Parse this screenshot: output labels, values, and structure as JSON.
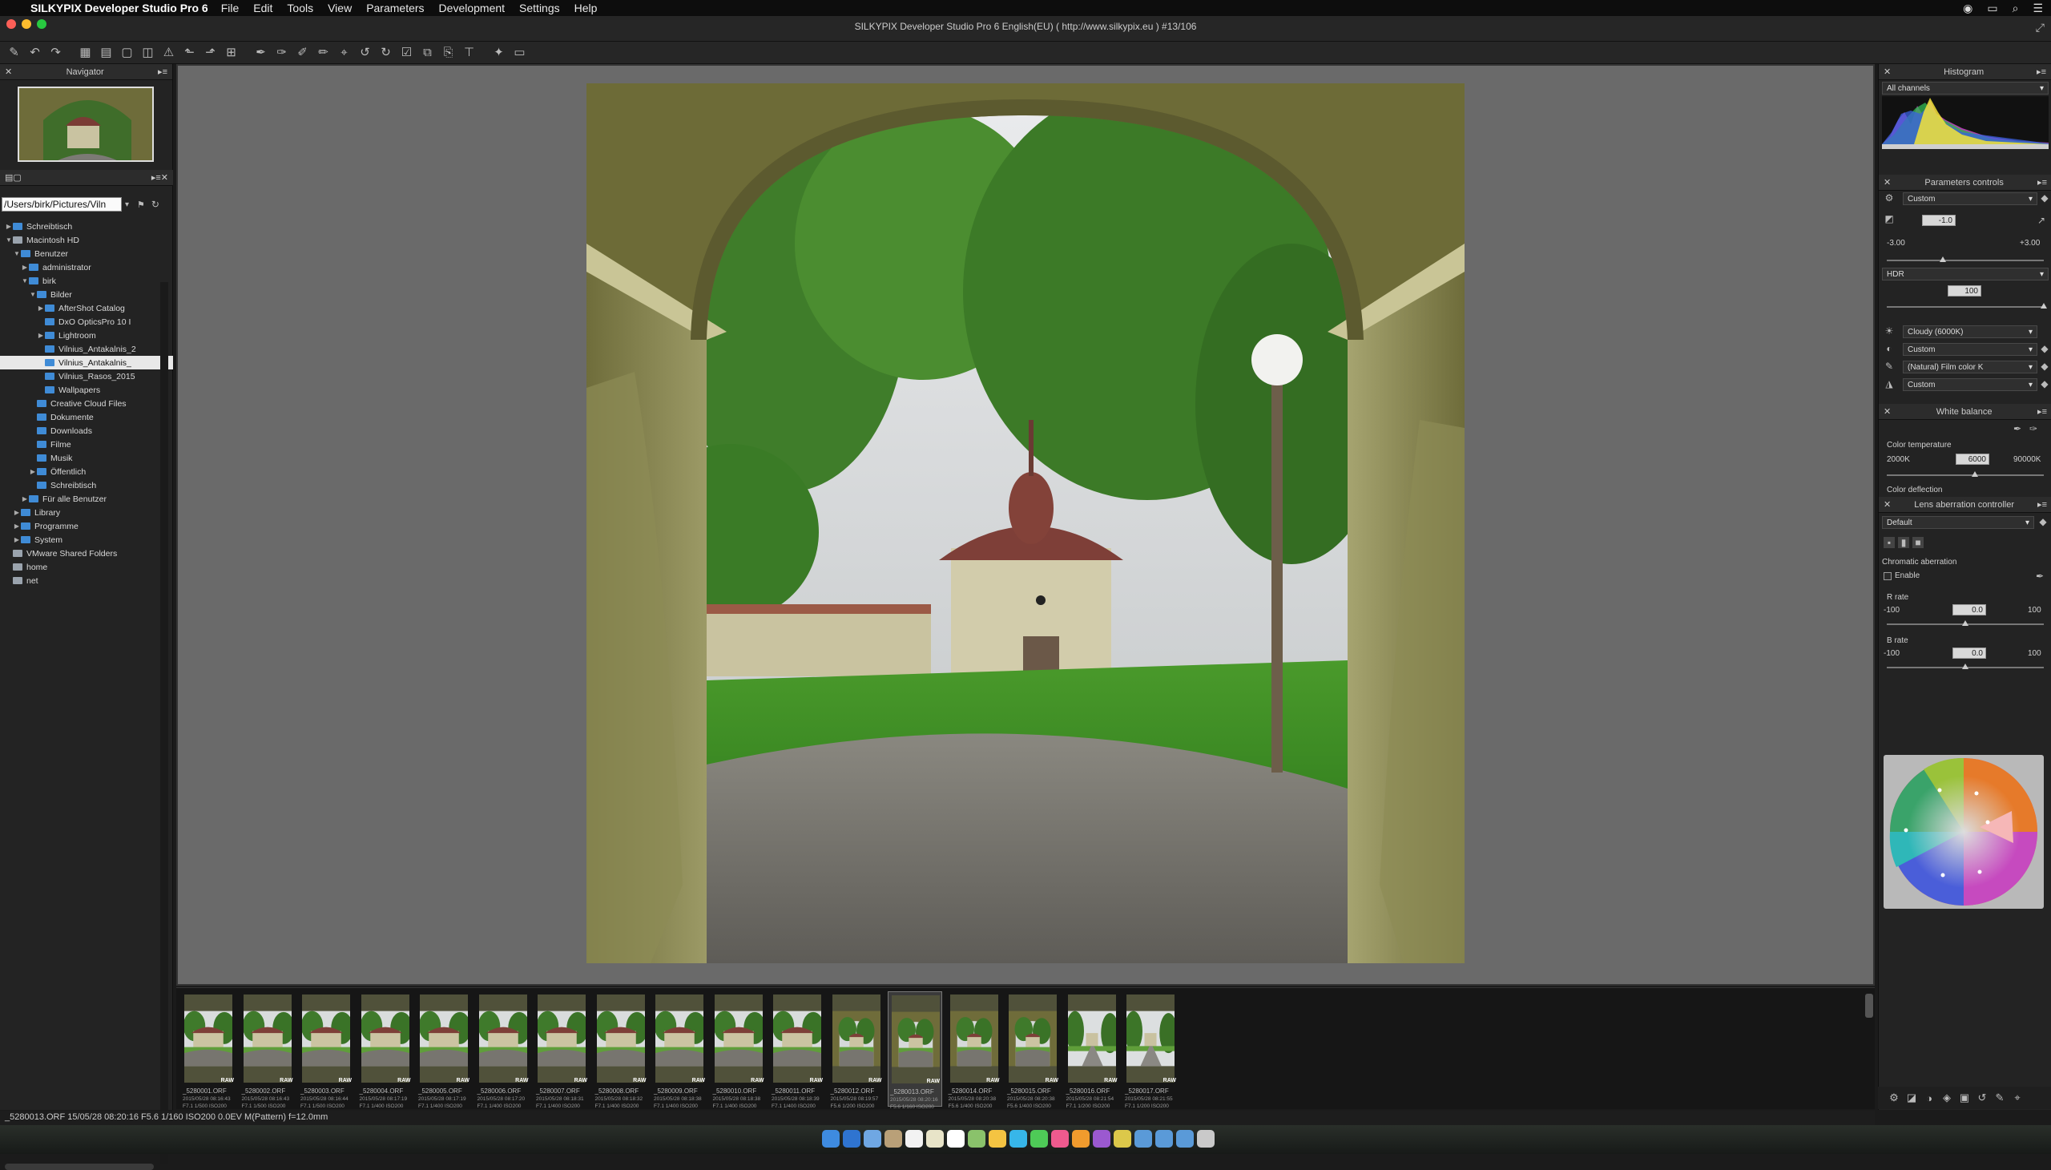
{
  "menubar": {
    "app_name": "SILKYPIX Developer Studio Pro 6",
    "menus": [
      "File",
      "Edit",
      "Tools",
      "View",
      "Parameters",
      "Development",
      "Settings",
      "Help"
    ]
  },
  "window": {
    "title": "SILKYPIX Developer Studio Pro 6 English(EU) ( http://www.silkypix.eu )  #13/106"
  },
  "toolbar": {
    "icons": [
      "pen-develop-icon",
      "undo-icon",
      "redo-icon",
      "grid-view-icon",
      "combined-view-icon",
      "preview-icon",
      "compare-icon",
      "warning-icon",
      "rotate-left-icon",
      "rotate-right-icon",
      "crop-grid-icon",
      "dropper-icon",
      "gray-dropper-icon",
      "brush-icon",
      "pen-icon",
      "spot-icon",
      "rotate-ccw-icon",
      "rotate-cw-icon",
      "check-mark-icon",
      "copy-params-icon",
      "paste-params-icon",
      "straighten-icon",
      "highlight-icon",
      "develop-output-icon"
    ]
  },
  "left_panel": {
    "navigator_title": "Navigator",
    "path_value": "/Users/birk/Pictures/Viln",
    "tree": [
      {
        "label": "Schreibtisch",
        "indent": 0,
        "tw": "▶",
        "drive": false,
        "sel": false
      },
      {
        "label": "Macintosh HD",
        "indent": 0,
        "tw": "▼",
        "drive": true,
        "sel": false
      },
      {
        "label": "Benutzer",
        "indent": 1,
        "tw": "▼",
        "drive": false,
        "sel": false
      },
      {
        "label": "administrator",
        "indent": 2,
        "tw": "▶",
        "drive": false,
        "sel": false
      },
      {
        "label": "birk",
        "indent": 2,
        "tw": "▼",
        "drive": false,
        "sel": false
      },
      {
        "label": "Bilder",
        "indent": 3,
        "tw": "▼",
        "drive": false,
        "sel": false
      },
      {
        "label": "AfterShot Catalog",
        "indent": 4,
        "tw": "▶",
        "drive": false,
        "sel": false
      },
      {
        "label": "DxO OpticsPro 10 I",
        "indent": 4,
        "tw": "",
        "drive": false,
        "sel": false
      },
      {
        "label": "Lightroom",
        "indent": 4,
        "tw": "▶",
        "drive": false,
        "sel": false
      },
      {
        "label": "Vilnius_Antakalnis_2",
        "indent": 4,
        "tw": "",
        "drive": false,
        "sel": false
      },
      {
        "label": "Vilnius_Antakalnis_",
        "indent": 4,
        "tw": "",
        "drive": false,
        "sel": true
      },
      {
        "label": "Vilnius_Rasos_2015",
        "indent": 4,
        "tw": "",
        "drive": false,
        "sel": false
      },
      {
        "label": "Wallpapers",
        "indent": 4,
        "tw": "",
        "drive": false,
        "sel": false
      },
      {
        "label": "Creative Cloud Files",
        "indent": 3,
        "tw": "",
        "drive": false,
        "sel": false
      },
      {
        "label": "Dokumente",
        "indent": 3,
        "tw": "",
        "drive": false,
        "sel": false
      },
      {
        "label": "Downloads",
        "indent": 3,
        "tw": "",
        "drive": false,
        "sel": false
      },
      {
        "label": "Filme",
        "indent": 3,
        "tw": "",
        "drive": false,
        "sel": false
      },
      {
        "label": "Musik",
        "indent": 3,
        "tw": "",
        "drive": false,
        "sel": false
      },
      {
        "label": "Öffentlich",
        "indent": 3,
        "tw": "▶",
        "drive": false,
        "sel": false
      },
      {
        "label": "Schreibtisch",
        "indent": 3,
        "tw": "",
        "drive": false,
        "sel": false
      },
      {
        "label": "Für alle Benutzer",
        "indent": 2,
        "tw": "▶",
        "drive": false,
        "sel": false
      },
      {
        "label": "Library",
        "indent": 1,
        "tw": "▶",
        "drive": false,
        "sel": false
      },
      {
        "label": "Programme",
        "indent": 1,
        "tw": "▶",
        "drive": false,
        "sel": false
      },
      {
        "label": "System",
        "indent": 1,
        "tw": "▶",
        "drive": false,
        "sel": false
      },
      {
        "label": "VMware Shared Folders",
        "indent": 0,
        "tw": "",
        "drive": true,
        "sel": false
      },
      {
        "label": "home",
        "indent": 0,
        "tw": "",
        "drive": true,
        "sel": false
      },
      {
        "label": "net",
        "indent": 0,
        "tw": "",
        "drive": true,
        "sel": false
      }
    ]
  },
  "filmstrip": {
    "raw_badge": "RAW",
    "items": [
      {
        "name": "_5280001.ORF",
        "date": "2015/05/28 08:16:43",
        "exif": "F7.1 1/500 ISO200",
        "variant": "a",
        "sel": false
      },
      {
        "name": "_5280002.ORF",
        "date": "2015/05/28 08:16:43",
        "exif": "F7.1 1/500 ISO200",
        "variant": "a",
        "sel": false
      },
      {
        "name": "_5280003.ORF",
        "date": "2015/05/28 08:16:44",
        "exif": "F7.1 1/500 ISO200",
        "variant": "a",
        "sel": false
      },
      {
        "name": "_5280004.ORF",
        "date": "2015/05/28 08:17:19",
        "exif": "F7.1 1/400 ISO200",
        "variant": "a",
        "sel": false
      },
      {
        "name": "_5280005.ORF",
        "date": "2015/05/28 08:17:19",
        "exif": "F7.1 1/400 ISO200",
        "variant": "a",
        "sel": false
      },
      {
        "name": "_5280006.ORF",
        "date": "2015/05/28 08:17:20",
        "exif": "F7.1 1/400 ISO200",
        "variant": "a",
        "sel": false
      },
      {
        "name": "_5280007.ORF",
        "date": "2015/05/28 08:18:31",
        "exif": "F7.1 1/400 ISO200",
        "variant": "a",
        "sel": false
      },
      {
        "name": "_5280008.ORF",
        "date": "2015/05/28 08:18:32",
        "exif": "F7.1 1/400 ISO200",
        "variant": "a",
        "sel": false
      },
      {
        "name": "_5280009.ORF",
        "date": "2015/05/28 08:18:38",
        "exif": "F7.1 1/400 ISO200",
        "variant": "a",
        "sel": false
      },
      {
        "name": "_5280010.ORF",
        "date": "2015/05/28 08:18:38",
        "exif": "F7.1 1/400 ISO200",
        "variant": "a",
        "sel": false
      },
      {
        "name": "_5280011.ORF",
        "date": "2015/05/28 08:18:39",
        "exif": "F7.1 1/400 ISO200",
        "variant": "a",
        "sel": false
      },
      {
        "name": "_5280012.ORF",
        "date": "2015/05/28 08:19:57",
        "exif": "F5.6 1/200 ISO200",
        "variant": "b",
        "sel": false
      },
      {
        "name": "_5280013.ORF",
        "date": "2015/05/28 08:20:16",
        "exif": "F5.6 1/160 ISO200",
        "variant": "b",
        "sel": true
      },
      {
        "name": "_5280014.ORF",
        "date": "2015/05/28 08:20:38",
        "exif": "F5.6 1/400 ISO200",
        "variant": "b",
        "sel": false
      },
      {
        "name": "_5280015.ORF",
        "date": "2015/05/28 08:20:38",
        "exif": "F5.6 1/400 ISO200",
        "variant": "b",
        "sel": false
      },
      {
        "name": "_5280016.ORF",
        "date": "2015/05/28 08:21:54",
        "exif": "F7.1 1/200 ISO200",
        "variant": "c",
        "sel": false
      },
      {
        "name": "_5280017.ORF",
        "date": "2015/05/28 08:21:55",
        "exif": "F7.1 1/200 ISO200",
        "variant": "c",
        "sel": false
      }
    ]
  },
  "statusbar": {
    "text": "_5280013.ORF  15/05/28 08:20:16  F5.6  1/160  ISO200    0.0EV  M(Pattern)  f=12.0mm"
  },
  "right_panel": {
    "histogram": {
      "title": "Histogram",
      "channel": "All channels"
    },
    "params": {
      "title": "Parameters controls",
      "taste": "Custom",
      "exposure_value": "-1.0",
      "exposure_min": "-3.00",
      "exposure_max": "+3.00",
      "hdr_label": "HDR",
      "hdr_value": "100",
      "wb": "Cloudy (6000K)",
      "tone": "Custom",
      "color": "(Natural) Film color K",
      "sharpness": "Custom"
    },
    "white_balance": {
      "title": "White balance",
      "temp_label": "Color temperature",
      "temp_min": "2000K",
      "temp_value": "6000",
      "temp_max": "90000K",
      "deflection_label": "Color deflection"
    },
    "lens": {
      "title": "Lens aberration controller",
      "preset": "Default",
      "chromatic_label": "Chromatic aberration",
      "enable_label": "Enable",
      "r_label": "R rate",
      "r_min": "-100",
      "r_value": "0.0",
      "r_max": "100",
      "b_label": "B rate",
      "b_min": "-100",
      "b_value": "0.0",
      "b_max": "100"
    }
  }
}
